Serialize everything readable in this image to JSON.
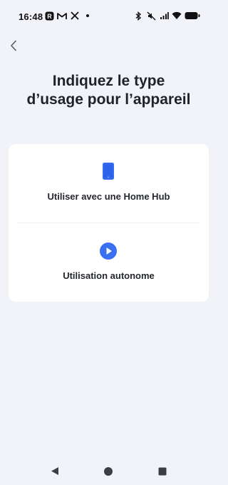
{
  "status_bar": {
    "time": "16:48",
    "left_icons": [
      "r-app-icon",
      "gmail-icon",
      "x-icon",
      "dot-icon"
    ],
    "right_icons": [
      "bluetooth-icon",
      "mute-icon",
      "signal-icon",
      "wifi-icon",
      "battery-icon"
    ]
  },
  "header": {
    "back_icon": "chevron-left-icon",
    "title": "Indiquez le type d’usage pour l’appareil"
  },
  "options": [
    {
      "icon": "tablet-icon",
      "label": "Utiliser avec une Home Hub"
    },
    {
      "icon": "play-circle-icon",
      "label": "Utilisation autonome"
    }
  ],
  "colors": {
    "background": "#f2f3f8",
    "card": "#ffffff",
    "accent": "#3a6ff2",
    "text": "#1f2227"
  },
  "nav_bar": [
    "nav-back-icon",
    "nav-home-icon",
    "nav-recents-icon"
  ]
}
